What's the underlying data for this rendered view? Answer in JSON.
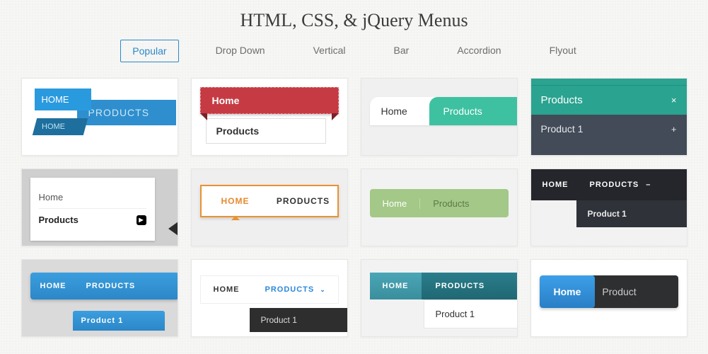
{
  "title": "HTML, CSS, & jQuery Menus",
  "tabs": [
    "Popular",
    "Drop Down",
    "Vertical",
    "Bar",
    "Accordion",
    "Flyout"
  ],
  "activeTab": 0,
  "cards": {
    "c1": {
      "home": "HOME",
      "products": "PRODUCTS",
      "home2": "HOME"
    },
    "c2": {
      "home": "Home",
      "products": "Products"
    },
    "c3": {
      "home": "Home",
      "products": "Products"
    },
    "c4": {
      "products": "Products",
      "close": "×",
      "product1": "Product 1",
      "plus": "+"
    },
    "c5": {
      "home": "Home",
      "products": "Products"
    },
    "c6": {
      "home": "HOME",
      "products": "PRODUCTS"
    },
    "c7": {
      "home": "Home",
      "products": "Products"
    },
    "c8": {
      "home": "HOME",
      "products": "PRODUCTS",
      "minus": "–",
      "product1": "Product 1"
    },
    "c9": {
      "home": "HOME",
      "products": "PRODUCTS",
      "product1": "Product 1"
    },
    "c10": {
      "home": "HOME",
      "products": "PRODUCTS",
      "product1": "Product 1"
    },
    "c11": {
      "home": "HOME",
      "products": "PRODUCTS",
      "product1": "Product 1"
    },
    "c12": {
      "home": "Home",
      "products": "Product"
    }
  }
}
